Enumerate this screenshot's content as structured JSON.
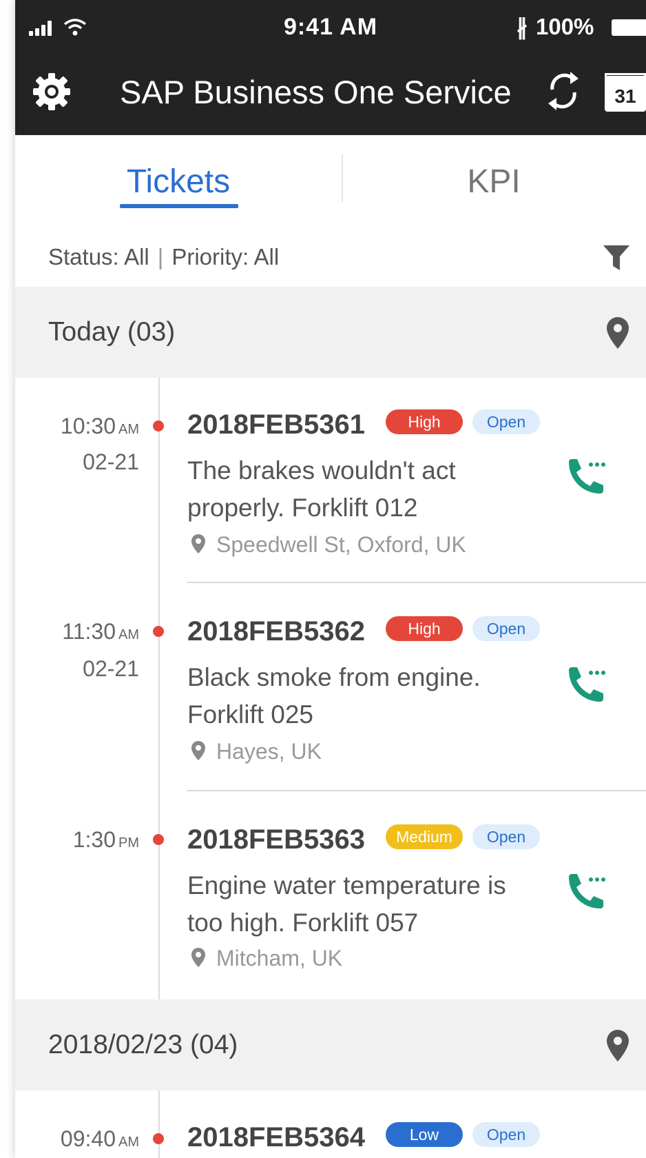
{
  "status_bar": {
    "time": "9:41 AM",
    "bluetooth": "∦",
    "battery": "100%"
  },
  "app_bar": {
    "title": "SAP Business One Service",
    "calendar_day": "31"
  },
  "tabs": [
    {
      "label": "Tickets",
      "active": true
    },
    {
      "label": "KPI",
      "active": false
    }
  ],
  "filter": {
    "status": "Status: All",
    "separator": "|",
    "priority": "Priority: All"
  },
  "sections": [
    {
      "title": "Today (03)"
    },
    {
      "title": "2018/02/23 (04)"
    }
  ],
  "tickets": [
    {
      "time": "10:30",
      "ampm": "AM",
      "date": "02-21",
      "id": "2018FEB5361",
      "priority": "High",
      "status": "Open",
      "description": "The brakes wouldn't act properly. Forklift 012",
      "location": "Speedwell St, Oxford, UK"
    },
    {
      "time": "11:30",
      "ampm": "AM",
      "date": "02-21",
      "id": "2018FEB5362",
      "priority": "High",
      "status": "Open",
      "description": "Black smoke from engine. Forklift 025",
      "location": "Hayes, UK"
    },
    {
      "time": "1:30",
      "ampm": "PM",
      "date": "",
      "id": "2018FEB5363",
      "priority": "Medium",
      "status": "Open",
      "description": "Engine water temperature is too high. Forklift 057",
      "location": "Mitcham, UK"
    },
    {
      "time": "09:40",
      "ampm": "AM",
      "date": "",
      "id": "2018FEB5364",
      "priority": "Low",
      "status": "Open",
      "description": "",
      "location": ""
    }
  ],
  "colors": {
    "header": "#232323",
    "accent": "#2a6fd0",
    "high": "#e5463a",
    "medium": "#f2be1a",
    "low": "#2a6fd0",
    "call": "#1a9a7a"
  },
  "icons": [
    "settings-gear-icon",
    "sync-icon",
    "calendar-icon",
    "filter-icon",
    "map-pin-icon",
    "phone-call-icon"
  ]
}
